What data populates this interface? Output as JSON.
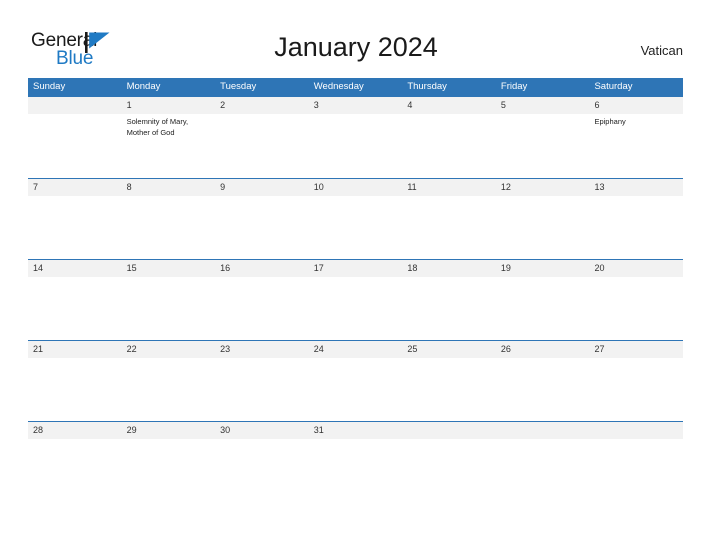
{
  "brand": {
    "name_part1": "General",
    "name_part2": "Blue",
    "flag_icon": "flag-triangle-icon",
    "primary_color": "#2e75b6",
    "logo_blue": "#1f7ac4",
    "band_gray": "#f2f2f2"
  },
  "header": {
    "title": "January 2024",
    "region": "Vatican"
  },
  "calendar": {
    "month": "January",
    "year": "2024",
    "weekday_headers": [
      "Sunday",
      "Monday",
      "Tuesday",
      "Wednesday",
      "Thursday",
      "Friday",
      "Saturday"
    ],
    "weeks": [
      {
        "days": [
          {
            "date": "",
            "event": ""
          },
          {
            "date": "1",
            "event": "Solemnity of Mary,\nMother of God"
          },
          {
            "date": "2",
            "event": ""
          },
          {
            "date": "3",
            "event": ""
          },
          {
            "date": "4",
            "event": ""
          },
          {
            "date": "5",
            "event": ""
          },
          {
            "date": "6",
            "event": "Epiphany"
          }
        ]
      },
      {
        "days": [
          {
            "date": "7",
            "event": ""
          },
          {
            "date": "8",
            "event": ""
          },
          {
            "date": "9",
            "event": ""
          },
          {
            "date": "10",
            "event": ""
          },
          {
            "date": "11",
            "event": ""
          },
          {
            "date": "12",
            "event": ""
          },
          {
            "date": "13",
            "event": ""
          }
        ]
      },
      {
        "days": [
          {
            "date": "14",
            "event": ""
          },
          {
            "date": "15",
            "event": ""
          },
          {
            "date": "16",
            "event": ""
          },
          {
            "date": "17",
            "event": ""
          },
          {
            "date": "18",
            "event": ""
          },
          {
            "date": "19",
            "event": ""
          },
          {
            "date": "20",
            "event": ""
          }
        ]
      },
      {
        "days": [
          {
            "date": "21",
            "event": ""
          },
          {
            "date": "22",
            "event": ""
          },
          {
            "date": "23",
            "event": ""
          },
          {
            "date": "24",
            "event": ""
          },
          {
            "date": "25",
            "event": ""
          },
          {
            "date": "26",
            "event": ""
          },
          {
            "date": "27",
            "event": ""
          }
        ]
      },
      {
        "days": [
          {
            "date": "28",
            "event": ""
          },
          {
            "date": "29",
            "event": ""
          },
          {
            "date": "30",
            "event": ""
          },
          {
            "date": "31",
            "event": ""
          },
          {
            "date": "",
            "event": ""
          },
          {
            "date": "",
            "event": ""
          },
          {
            "date": "",
            "event": ""
          }
        ]
      }
    ]
  }
}
